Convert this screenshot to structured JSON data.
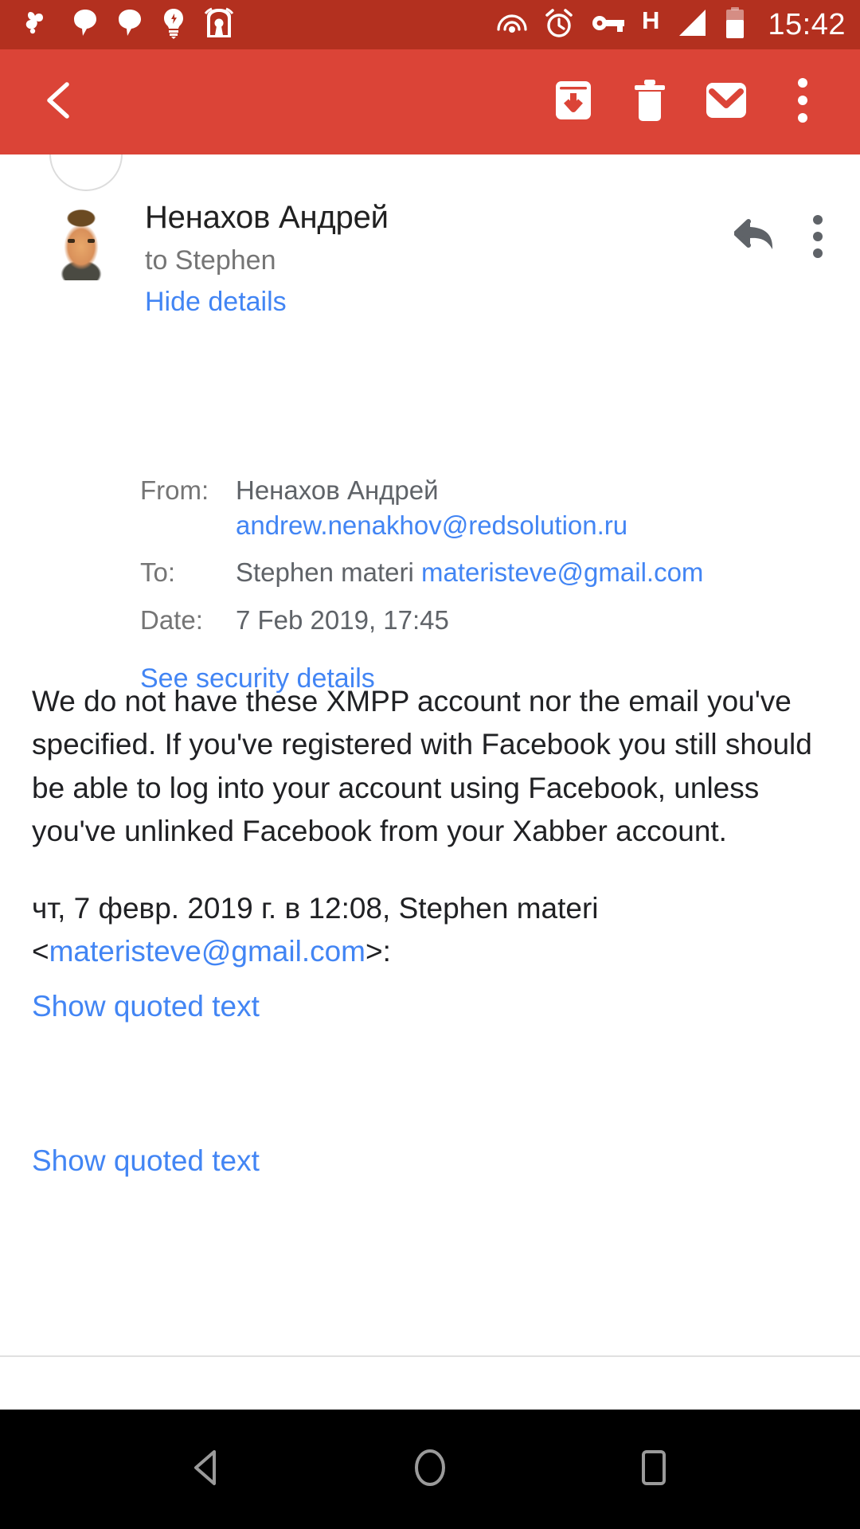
{
  "status_bar": {
    "background": "#b3301f",
    "left_icons": [
      {
        "name": "xabber-icon"
      },
      {
        "name": "chat-bubble-icon"
      },
      {
        "name": "chat-bubble-icon"
      },
      {
        "name": "lightbulb-icon"
      },
      {
        "name": "app-notification-icon"
      }
    ],
    "right_icons": [
      {
        "name": "cast-icon"
      },
      {
        "name": "alarm-icon"
      },
      {
        "name": "vpn-key-icon"
      },
      {
        "name": "network-hspa-icon",
        "label": "H"
      },
      {
        "name": "signal-cellular-icon"
      },
      {
        "name": "battery-icon"
      }
    ],
    "clock": "15:42"
  },
  "app_bar": {
    "background": "#db4437",
    "actions": [
      {
        "name": "back-button",
        "label": "Back"
      },
      {
        "name": "archive-button",
        "label": "Archive"
      },
      {
        "name": "delete-button",
        "label": "Delete"
      },
      {
        "name": "mark-unread-button",
        "label": "Mark unread"
      },
      {
        "name": "more-options-button",
        "label": "More options"
      }
    ]
  },
  "message": {
    "sender_name": "Ненахов Андрей",
    "to_line": "to Stephen",
    "details_toggle": "Hide details",
    "reply_all_label": "Reply all",
    "more_label": "More options",
    "details": {
      "from_label": "From:",
      "from_name": "Ненахов Андрей",
      "from_email": "andrew.nenakhov@redsolution.ru",
      "to_label": "To:",
      "to_name": "Stephen materi",
      "to_email": "materisteve@gmail.com",
      "date_label": "Date:",
      "date_value": "7 Feb 2019, 17:45",
      "security_link": "See security details"
    },
    "body_paragraph": "We do not have these XMPP account nor the email you've specified. If you've registered with Facebook you still should be able to log into your account using Facebook, unless you've unlinked Facebook from your Xabber account.",
    "quote_header_prefix": "чт, 7 февр. 2019 г. в 12:08, Stephen materi <",
    "quote_header_email": "materisteve@gmail.com",
    "quote_header_suffix": ">:",
    "show_quoted_1": "Show quoted text",
    "show_quoted_2": "Show quoted text"
  },
  "nav_bar": {
    "background": "#000000",
    "buttons": [
      {
        "name": "nav-back-button",
        "label": "Back"
      },
      {
        "name": "nav-home-button",
        "label": "Home"
      },
      {
        "name": "nav-recents-button",
        "label": "Recents"
      }
    ]
  },
  "colors": {
    "status_bar": "#b3301f",
    "app_bar": "#db4437",
    "link": "#4285f4",
    "primary_text": "#202124",
    "secondary_text": "#757575"
  }
}
